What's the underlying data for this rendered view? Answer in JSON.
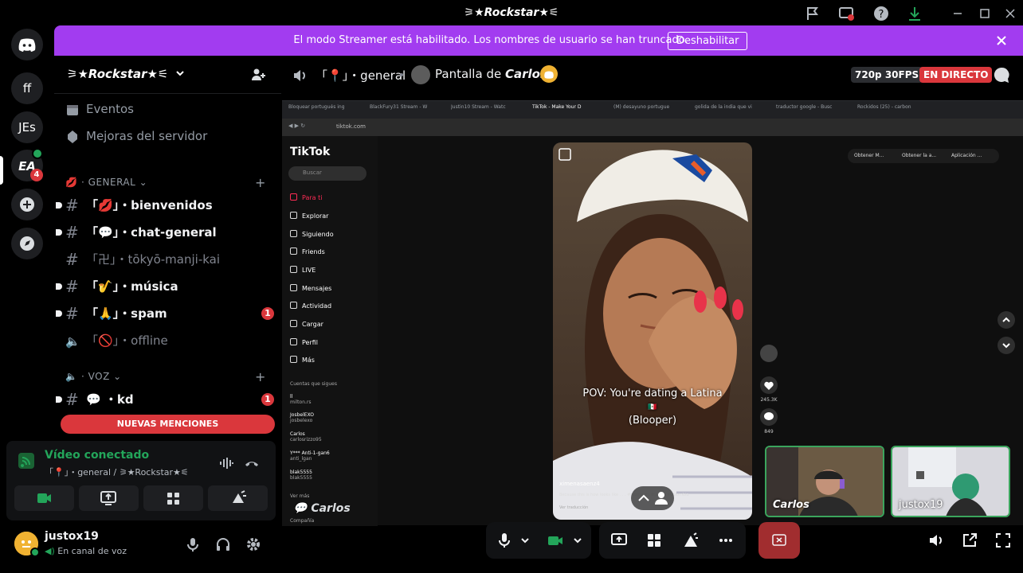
{
  "window": {
    "title": "⚞★Rockstar★⚟"
  },
  "streamer_bar": {
    "message": "El modo Streamer está habilitado. Los nombres de usuario se han truncado.",
    "disable_label": "Deshabilitar"
  },
  "rail": {
    "guilds": [
      "ff",
      "JEs"
    ],
    "ea_badge": "4"
  },
  "server": {
    "name": "⚞★Rockstar★⚟",
    "events": "Eventos",
    "boosts": "Mejoras del servidor",
    "category_general": "GENERAL",
    "category_voz": "VOZ",
    "channels": [
      {
        "label": "「💋」・bienvenidos"
      },
      {
        "label": "「💬」・chat-general"
      },
      {
        "label": "「卍」・tōkyō-manji-kai"
      },
      {
        "label": "「🎷」・música"
      },
      {
        "label": "「🙏」・spam",
        "badge": "1"
      },
      {
        "label": "「🚫」・offline"
      },
      {
        "label": "💬 ・kd",
        "badge": "1"
      }
    ],
    "new_mentions": "NUEVAS MENCIONES"
  },
  "voice": {
    "status": "Vídeo conectado",
    "location": "「📍」・general / ⚞★Rockstar★⚟"
  },
  "user": {
    "name": "justox19",
    "status": "En canal de voz"
  },
  "header": {
    "channel": "「📍」・general",
    "stream_owner_prefix": "Pantalla de",
    "stream_owner": "Carlos",
    "quality": "720p 30FPS",
    "live": "EN DIRECTO"
  },
  "stream": {
    "browser_tabs": [
      "Bloquear portugués ing",
      "BlackFury31 Stream - W",
      "Justin10 Stream - Watc",
      "TikTok - Make Your D",
      "(M) desayuno portugue",
      "golida de la india que vi",
      "traductor google - Busc",
      "Rockidos (25) - carbon"
    ],
    "address": "tiktok.com",
    "tiktok_logo": "TikTok",
    "search_placeholder": "Buscar",
    "nav": [
      "Para ti",
      "Explorar",
      "Siguiendo",
      "Friends",
      "LIVE",
      "Mensajes",
      "Actividad",
      "Cargar",
      "Perfil",
      "Más"
    ],
    "following_title": "Cuentas que sigues",
    "following": [
      {
        "name": "ll",
        "handle": "milton.rs"
      },
      {
        "name": "JosbelEXO",
        "handle": "josbelexo"
      },
      {
        "name": "Carlos",
        "handle": "carlosrizzo95"
      },
      {
        "name": "Y*** Anti-1-gan6",
        "handle": "anti_lgan"
      },
      {
        "name": "blak5555",
        "handle": "blak5555"
      }
    ],
    "see_more": "Ver más",
    "company": "Compañía",
    "top_actions": [
      "Obtener M...",
      "Obtener la a...",
      "Aplicación ..."
    ],
    "caption_line1": "POV: You're dating a Latina",
    "caption_line2": "(Blooper)",
    "video_author": "ximenasaenz4",
    "video_desc": "Because this is how looks like . . . #momento #latina #Colombia",
    "video_translate": "Ver traducción",
    "likes": "245.3K",
    "comments": "849",
    "streamer_label": "Carlos",
    "tiles": [
      "Carlos",
      "justox19"
    ]
  },
  "colors": {
    "accent": "#a23cf0",
    "online": "#23a55a",
    "danger": "#da373c"
  }
}
